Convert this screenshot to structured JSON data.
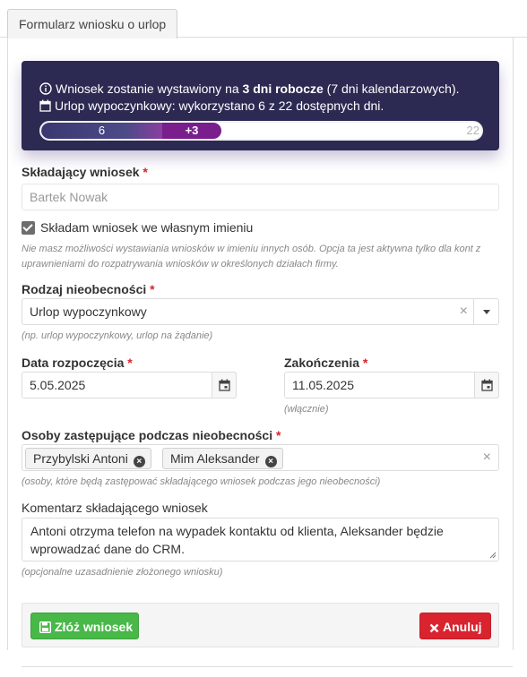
{
  "tab": {
    "label": "Formularz wniosku o urlop"
  },
  "info": {
    "line1_prefix": "Wniosek zostanie wystawiony na ",
    "line1_bold": "3 dni robocze",
    "line1_suffix": " (7 dni kalendarzowych).",
    "line2": "Urlop wypoczynkowy: wykorzystano 6 z 22 dostępnych dni.",
    "progress": {
      "used": 6,
      "requested": 3,
      "total": 22,
      "used_label": "6",
      "requested_label": "+3",
      "total_label": "22"
    },
    "info_icon": "info-circle-icon",
    "calendar_icon": "calendar-icon"
  },
  "applicant": {
    "label": "Składający wniosek",
    "required_mark": "*",
    "value": "Bartek Nowak"
  },
  "own_name": {
    "label": "Składam wniosek we własnym imieniu",
    "checked": true,
    "help": "Nie masz możliwości wystawiania wniosków w imieniu innych osób. Opcja ta jest aktywna tylko dla kont z uprawnieniami do rozpatrywania wniosków w określonych działach firmy."
  },
  "absence_type": {
    "label": "Rodzaj nieobecności",
    "required_mark": "*",
    "value": "Urlop wypoczynkowy",
    "clear": "×",
    "help": "(np. urlop wypoczynkowy, urlop na żądanie)"
  },
  "start_date": {
    "label": "Data rozpoczęcia",
    "required_mark": "*",
    "value": "5.05.2025"
  },
  "end_date": {
    "label": "Zakończenia",
    "required_mark": "*",
    "value": "11.05.2025",
    "help": "(włącznie)"
  },
  "substitutes": {
    "label": "Osoby zastępujące podczas nieobecności",
    "required_mark": "*",
    "tags": [
      "Przybylski Antoni",
      "Mim Aleksander"
    ],
    "tag_remove": "×",
    "clear": "×",
    "help": "(osoby, które będą zastępować składającego wniosek podczas jego nieobecności)"
  },
  "comment": {
    "label": "Komentarz składającego wniosek",
    "value": "Antoni otrzyma telefon na wypadek kontaktu od klienta, Aleksander będzie wprowadzać dane do CRM.",
    "help": "(opcjonalne uzasadnienie złożonego wniosku)"
  },
  "actions": {
    "submit_label": "Złóż wniosek",
    "cancel_label": "Anuluj",
    "submit_color": "#48b848",
    "cancel_color": "#d9232e"
  }
}
